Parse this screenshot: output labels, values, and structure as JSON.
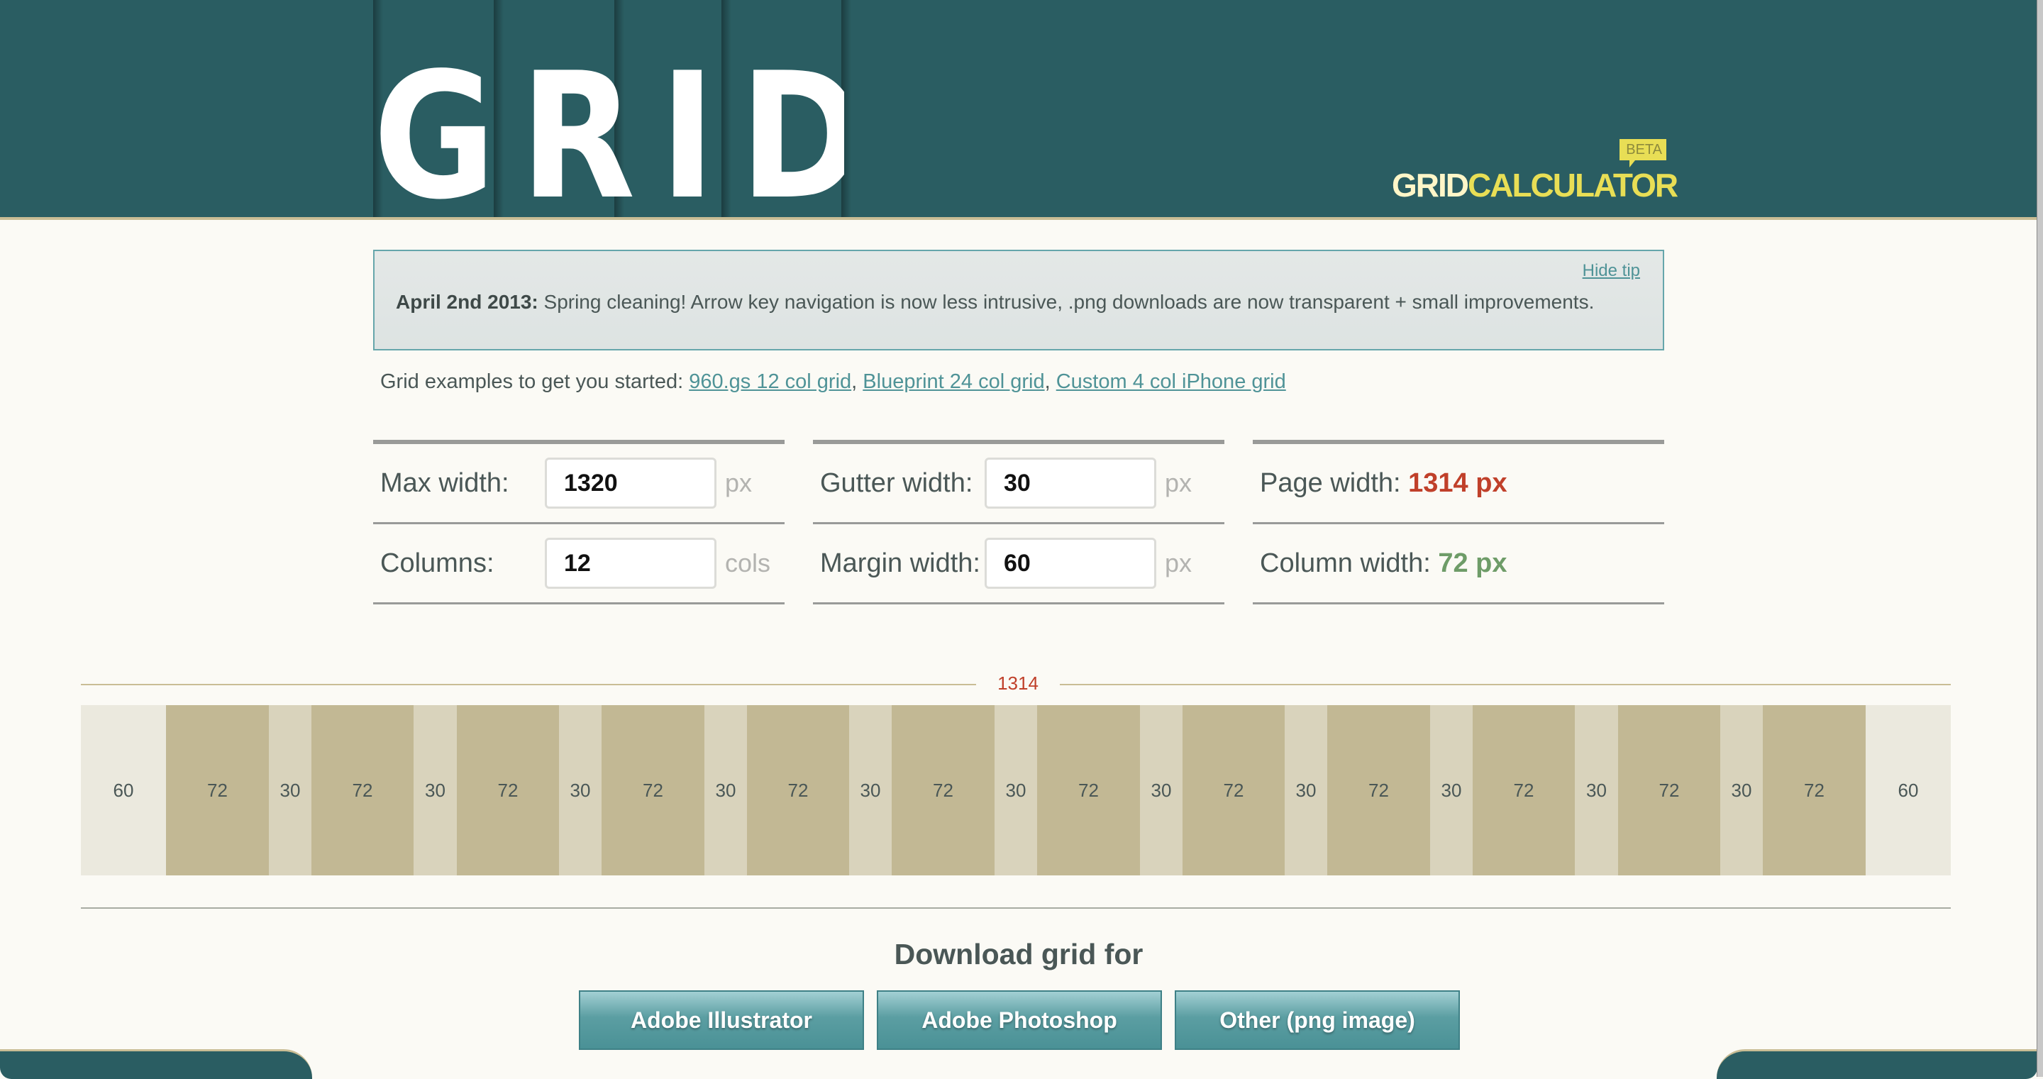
{
  "header": {
    "logo_text": "GRID",
    "brand_part1": "GRID",
    "brand_part2": "CALCULATOR",
    "badge": "BETA",
    "colors": {
      "background": "#2a5d62",
      "brand_light": "#fff6c8",
      "brand_accent": "#e8de55"
    }
  },
  "tip": {
    "date": "April 2nd 2013:",
    "message": " Spring cleaning! Arrow key navigation is now less intrusive, .png downloads are now transparent + small improvements.",
    "hide_label": "Hide tip"
  },
  "examples": {
    "intro": "Grid examples to get you started: ",
    "links": [
      {
        "label": "960.gs 12 col grid"
      },
      {
        "label": "Blueprint 24 col grid"
      },
      {
        "label": "Custom 4 col iPhone grid"
      }
    ],
    "separator": ", "
  },
  "form": {
    "max_width": {
      "label": "Max width:",
      "value": "1320",
      "unit": "px"
    },
    "columns": {
      "label": "Columns:",
      "value": "12",
      "unit": "cols"
    },
    "gutter_width": {
      "label": "Gutter width:",
      "value": "30",
      "unit": "px"
    },
    "margin_width": {
      "label": "Margin width:",
      "value": "60",
      "unit": "px"
    },
    "page_width": {
      "label": "Page width: ",
      "value": "1314 px",
      "color": "#c0402a"
    },
    "column_width": {
      "label": "Column width: ",
      "value": "72 px",
      "color": "#6e9c68"
    }
  },
  "preview": {
    "total_label": "1314",
    "segments": [
      {
        "type": "margin",
        "value": 60
      },
      {
        "type": "col",
        "value": 72
      },
      {
        "type": "gutter",
        "value": 30
      },
      {
        "type": "col",
        "value": 72
      },
      {
        "type": "gutter",
        "value": 30
      },
      {
        "type": "col",
        "value": 72
      },
      {
        "type": "gutter",
        "value": 30
      },
      {
        "type": "col",
        "value": 72
      },
      {
        "type": "gutter",
        "value": 30
      },
      {
        "type": "col",
        "value": 72
      },
      {
        "type": "gutter",
        "value": 30
      },
      {
        "type": "col",
        "value": 72
      },
      {
        "type": "gutter",
        "value": 30
      },
      {
        "type": "col",
        "value": 72
      },
      {
        "type": "gutter",
        "value": 30
      },
      {
        "type": "col",
        "value": 72
      },
      {
        "type": "gutter",
        "value": 30
      },
      {
        "type": "col",
        "value": 72
      },
      {
        "type": "gutter",
        "value": 30
      },
      {
        "type": "col",
        "value": 72
      },
      {
        "type": "gutter",
        "value": 30
      },
      {
        "type": "col",
        "value": 72
      },
      {
        "type": "gutter",
        "value": 30
      },
      {
        "type": "col",
        "value": 72
      },
      {
        "type": "margin",
        "value": 60
      }
    ],
    "colors": {
      "margin": "#ebe9de",
      "col": "#c2b894",
      "gutter": "#d9d3bc"
    }
  },
  "download": {
    "title": "Download grid for",
    "buttons": [
      {
        "label": "Adobe Illustrator"
      },
      {
        "label": "Adobe Photoshop"
      },
      {
        "label": "Other (png image)"
      }
    ]
  }
}
